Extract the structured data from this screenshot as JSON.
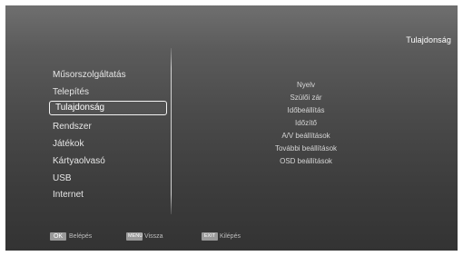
{
  "header": {
    "title": "Tulajdonság"
  },
  "menu": {
    "items": [
      {
        "label": "Műsorszolgáltatás"
      },
      {
        "label": "Telepítés"
      },
      {
        "label": "Tulajdonság"
      },
      {
        "label": "Rendszer"
      },
      {
        "label": "Játékok"
      },
      {
        "label": "Kártyaolvasó"
      },
      {
        "label": "USB"
      },
      {
        "label": "Internet"
      }
    ],
    "selected": "Tulajdonság"
  },
  "submenu": {
    "items": [
      {
        "label": "Nyelv"
      },
      {
        "label": "Szülői zár"
      },
      {
        "label": "Időbeállítás"
      },
      {
        "label": "Időzítő"
      },
      {
        "label": "A/V beállítások"
      },
      {
        "label": "További beállítások"
      },
      {
        "label": "OSD beállítások"
      }
    ]
  },
  "footer": {
    "hints": [
      {
        "key": "OK",
        "label": "Belépés"
      },
      {
        "key": "MENU",
        "label": "Vissza"
      },
      {
        "key": "EXIT",
        "label": "Kilépés"
      }
    ]
  },
  "colors": {
    "background_top": "#6f6f6f",
    "background_bottom": "#333333",
    "text": "#e6e6e6",
    "selection_border": "#f2f2f2",
    "key_badge": "#9a9a9a"
  }
}
